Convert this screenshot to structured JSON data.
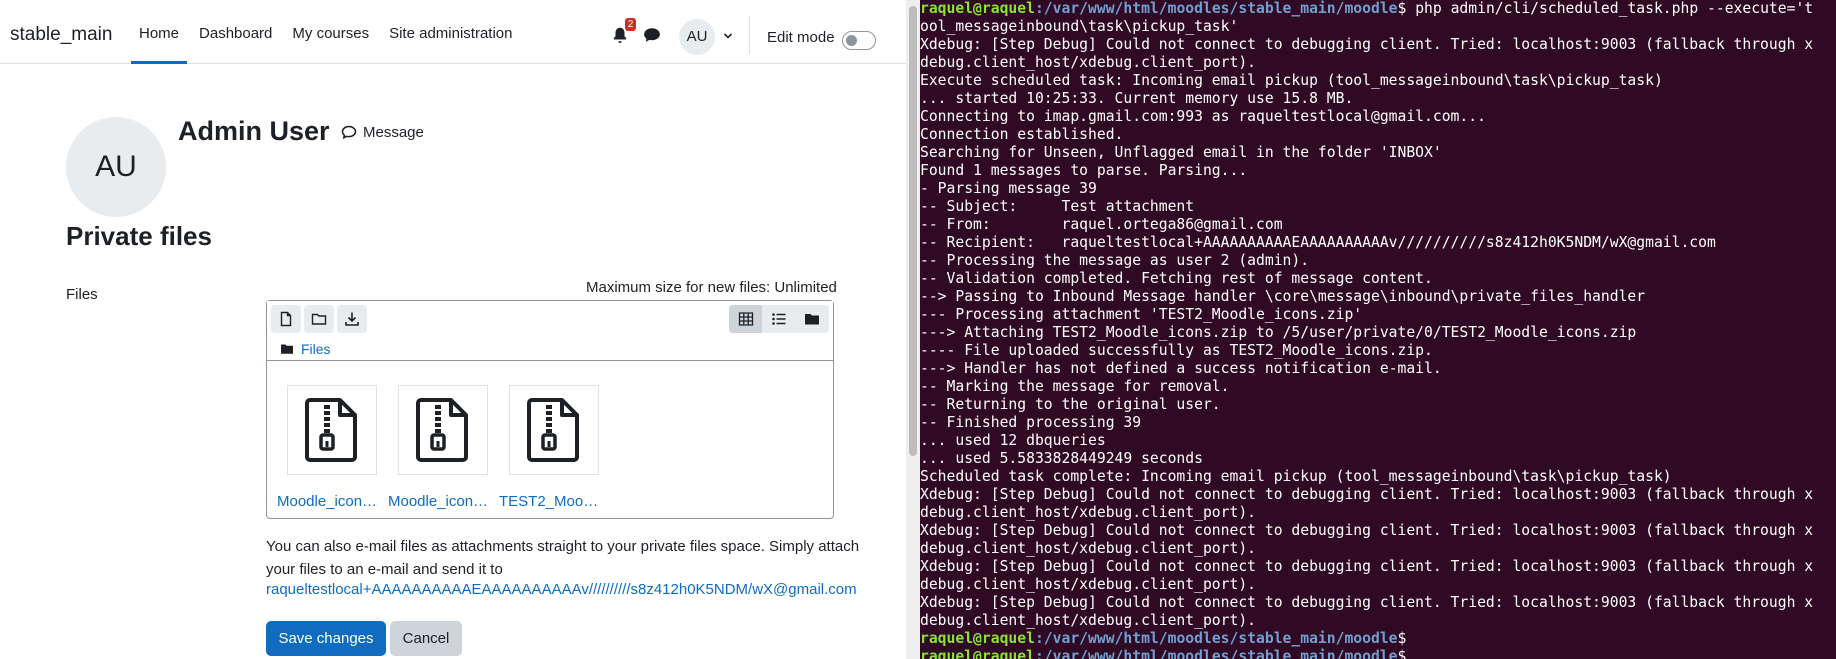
{
  "moodle": {
    "site_name": "stable_main",
    "nav": [
      "Home",
      "Dashboard",
      "My courses",
      "Site administration"
    ],
    "notification_count": "2",
    "user_initials": "AU",
    "edit_mode_label": "Edit mode",
    "profile": {
      "initials": "AU",
      "name": "Admin User",
      "message_label": "Message"
    },
    "page_title": "Private files",
    "files_label": "Files",
    "max_size_text": "Maximum size for new files: Unlimited",
    "breadcrumb": "Files",
    "files": [
      {
        "name": "Moodle_icon…"
      },
      {
        "name": "Moodle_icon…"
      },
      {
        "name": "TEST2_Moo…"
      }
    ],
    "note_text": "You can also e-mail files as attachments straight to your private files space. Simply attach your files to an e-mail and send it to",
    "note_email": "raqueltestlocal+AAAAAAAAAAEAAAAAAAAAAv//////////s8z412h0K5NDM/wX@gmail.com",
    "save_label": "Save changes",
    "cancel_label": "Cancel"
  },
  "terminal": {
    "lines": [
      {
        "type": "prompt",
        "user": "raquel@raquel",
        "path": ":/var/www/html/moodles/stable_main/moodle",
        "cmd": "$ php admin/cli/scheduled_task.php --execute='t"
      },
      {
        "type": "text",
        "text": "ool_messageinbound\\task\\pickup_task'"
      },
      {
        "type": "text",
        "text": "Xdebug: [Step Debug] Could not connect to debugging client. Tried: localhost:9003 (fallback through x"
      },
      {
        "type": "text",
        "text": "debug.client_host/xdebug.client_port)."
      },
      {
        "type": "text",
        "text": "Execute scheduled task: Incoming email pickup (tool_messageinbound\\task\\pickup_task)"
      },
      {
        "type": "text",
        "text": "... started 10:25:33. Current memory use 15.8 MB."
      },
      {
        "type": "text",
        "text": "Connecting to imap.gmail.com:993 as raqueltestlocal@gmail.com..."
      },
      {
        "type": "text",
        "text": "Connection established."
      },
      {
        "type": "text",
        "text": "Searching for Unseen, Unflagged email in the folder 'INBOX'"
      },
      {
        "type": "text",
        "text": "Found 1 messages to parse. Parsing..."
      },
      {
        "type": "text",
        "text": "- Parsing message 39"
      },
      {
        "type": "text",
        "text": "-- Subject:     Test attachment"
      },
      {
        "type": "text",
        "text": "-- From:        raquel.ortega86@gmail.com"
      },
      {
        "type": "text",
        "text": "-- Recipient:   raqueltestlocal+AAAAAAAAAAEAAAAAAAAAAv//////////s8z412h0K5NDM/wX@gmail.com"
      },
      {
        "type": "text",
        "text": "-- Processing the message as user 2 (admin)."
      },
      {
        "type": "text",
        "text": "-- Validation completed. Fetching rest of message content."
      },
      {
        "type": "text",
        "text": "--> Passing to Inbound Message handler \\core\\message\\inbound\\private_files_handler"
      },
      {
        "type": "text",
        "text": "--- Processing attachment 'TEST2_Moodle_icons.zip'"
      },
      {
        "type": "text",
        "text": "---> Attaching TEST2_Moodle_icons.zip to /5/user/private/0/TEST2_Moodle_icons.zip"
      },
      {
        "type": "text",
        "text": "---- File uploaded successfully as TEST2_Moodle_icons.zip."
      },
      {
        "type": "text",
        "text": "---> Handler has not defined a success notification e-mail."
      },
      {
        "type": "text",
        "text": "-- Marking the message for removal."
      },
      {
        "type": "text",
        "text": "-- Returning to the original user."
      },
      {
        "type": "text",
        "text": "-- Finished processing 39"
      },
      {
        "type": "text",
        "text": "... used 12 dbqueries"
      },
      {
        "type": "text",
        "text": "... used 5.5833828449249 seconds"
      },
      {
        "type": "text",
        "text": "Scheduled task complete: Incoming email pickup (tool_messageinbound\\task\\pickup_task)"
      },
      {
        "type": "text",
        "text": "Xdebug: [Step Debug] Could not connect to debugging client. Tried: localhost:9003 (fallback through x"
      },
      {
        "type": "text",
        "text": "debug.client_host/xdebug.client_port)."
      },
      {
        "type": "text",
        "text": "Xdebug: [Step Debug] Could not connect to debugging client. Tried: localhost:9003 (fallback through x"
      },
      {
        "type": "text",
        "text": "debug.client_host/xdebug.client_port)."
      },
      {
        "type": "text",
        "text": "Xdebug: [Step Debug] Could not connect to debugging client. Tried: localhost:9003 (fallback through x"
      },
      {
        "type": "text",
        "text": "debug.client_host/xdebug.client_port)."
      },
      {
        "type": "text",
        "text": "Xdebug: [Step Debug] Could not connect to debugging client. Tried: localhost:9003 (fallback through x"
      },
      {
        "type": "text",
        "text": "debug.client_host/xdebug.client_port)."
      },
      {
        "type": "prompt",
        "user": "raquel@raquel",
        "path": ":/var/www/html/moodles/stable_main/moodle",
        "cmd": "$"
      },
      {
        "type": "prompt",
        "user": "raquel@raquel",
        "path": ":/var/www/html/moodles/stable_main/moodle",
        "cmd": "$"
      }
    ]
  },
  "icons": {
    "bell": "bell-icon",
    "chat": "chat-icon",
    "file_new": "new-file-icon",
    "folder_new": "new-folder-icon",
    "download": "download-icon",
    "view_grid": "grid-view-icon",
    "view_list": "list-view-icon",
    "view_tree": "folder-view-icon",
    "zip": "zip-file-icon"
  },
  "colors": {
    "accent": "#0f6cbf",
    "terminal_bg": "#300a24",
    "prompt_user": "#8ae234",
    "prompt_path": "#729fcf",
    "badge": "#ca3120"
  }
}
